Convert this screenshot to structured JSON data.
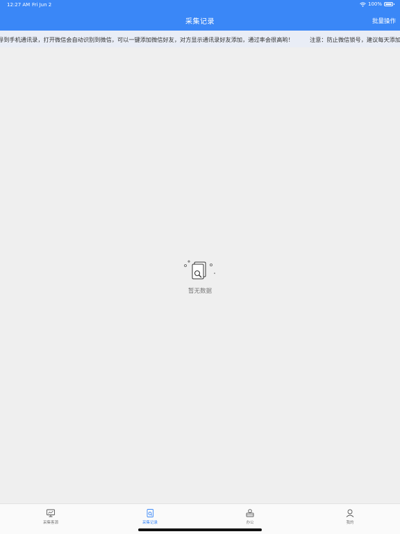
{
  "status_bar": {
    "time": "12:27 AM",
    "date": "Fri Jun 2",
    "battery": "100%"
  },
  "nav": {
    "title": "采集记录",
    "action": "批量操作"
  },
  "notice": {
    "text_part1": "导到手机通讯录，打开微信会自动识别到微信，可以一键添加微信好友，对方显示通讯录好友添加，通过率会很高哟！",
    "text_part2": "注意：防止微信锁号，建议每天添加"
  },
  "empty_state": {
    "icon": "empty-box-search-icon",
    "text": "暂无数据"
  },
  "tabs": [
    {
      "label": "采集客源",
      "icon": "monitor-icon",
      "active": false
    },
    {
      "label": "采集记录",
      "icon": "record-icon",
      "active": true
    },
    {
      "label": "办公",
      "icon": "office-icon",
      "active": false
    },
    {
      "label": "我的",
      "icon": "user-icon",
      "active": false
    }
  ],
  "colors": {
    "accent": "#3a87f7",
    "background": "#efefef"
  }
}
